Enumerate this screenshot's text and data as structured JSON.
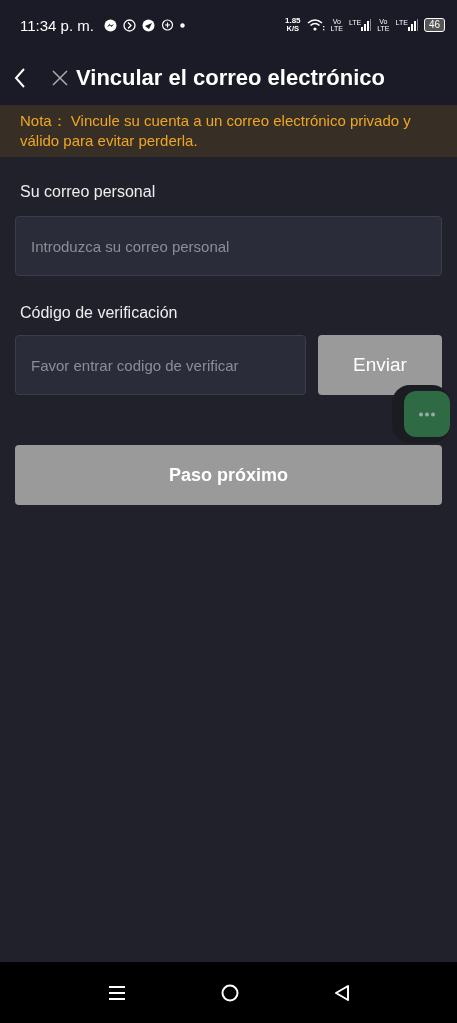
{
  "status_bar": {
    "time": "11:34 p. m.",
    "speed": "1.85",
    "speed_unit": "K/S",
    "sims": [
      {
        "volte": "Vo",
        "volte_sub": "LTE",
        "network": "LTE"
      },
      {
        "volte": "Vo",
        "volte_sub": "LTE",
        "network": "LTE"
      }
    ],
    "battery": "46"
  },
  "header": {
    "title": "Vincular el correo electrónico"
  },
  "notice": {
    "label": "Nota：",
    "text": "Vincule su cuenta a un correo electrónico privado y válido para evitar perderla."
  },
  "email": {
    "label": "Su correo personal",
    "placeholder": "Introduzca su correo personal"
  },
  "code": {
    "label": "Código de verificación",
    "placeholder": "Favor entrar codigo de verificar"
  },
  "send_button": {
    "label": "Enviar",
    "disabled": true
  },
  "next_button": {
    "label": "Paso próximo",
    "disabled": true
  }
}
